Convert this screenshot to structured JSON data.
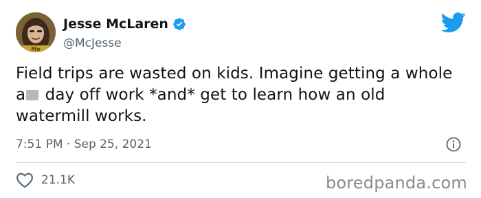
{
  "author": {
    "display_name": "Jesse McLaren",
    "handle": "@McJesse",
    "avatar_caption": "Me"
  },
  "tweet": {
    "text_part1": "Field trips are wasted on kids. Imagine getting a whole a",
    "text_part2": " day off work *and* get to learn how an old watermill works.",
    "timestamp": "7:51 PM · Sep 25, 2021"
  },
  "engagement": {
    "likes": "21.1K"
  },
  "watermark": "boredpanda.com",
  "colors": {
    "twitter_blue": "#1d9bf0",
    "text": "#0f1419",
    "muted": "#536471",
    "divider": "#cfd9de"
  },
  "icons": {
    "verified": "verified-badge-icon",
    "brand": "twitter-bird-icon",
    "info": "info-icon",
    "like": "heart-icon"
  }
}
